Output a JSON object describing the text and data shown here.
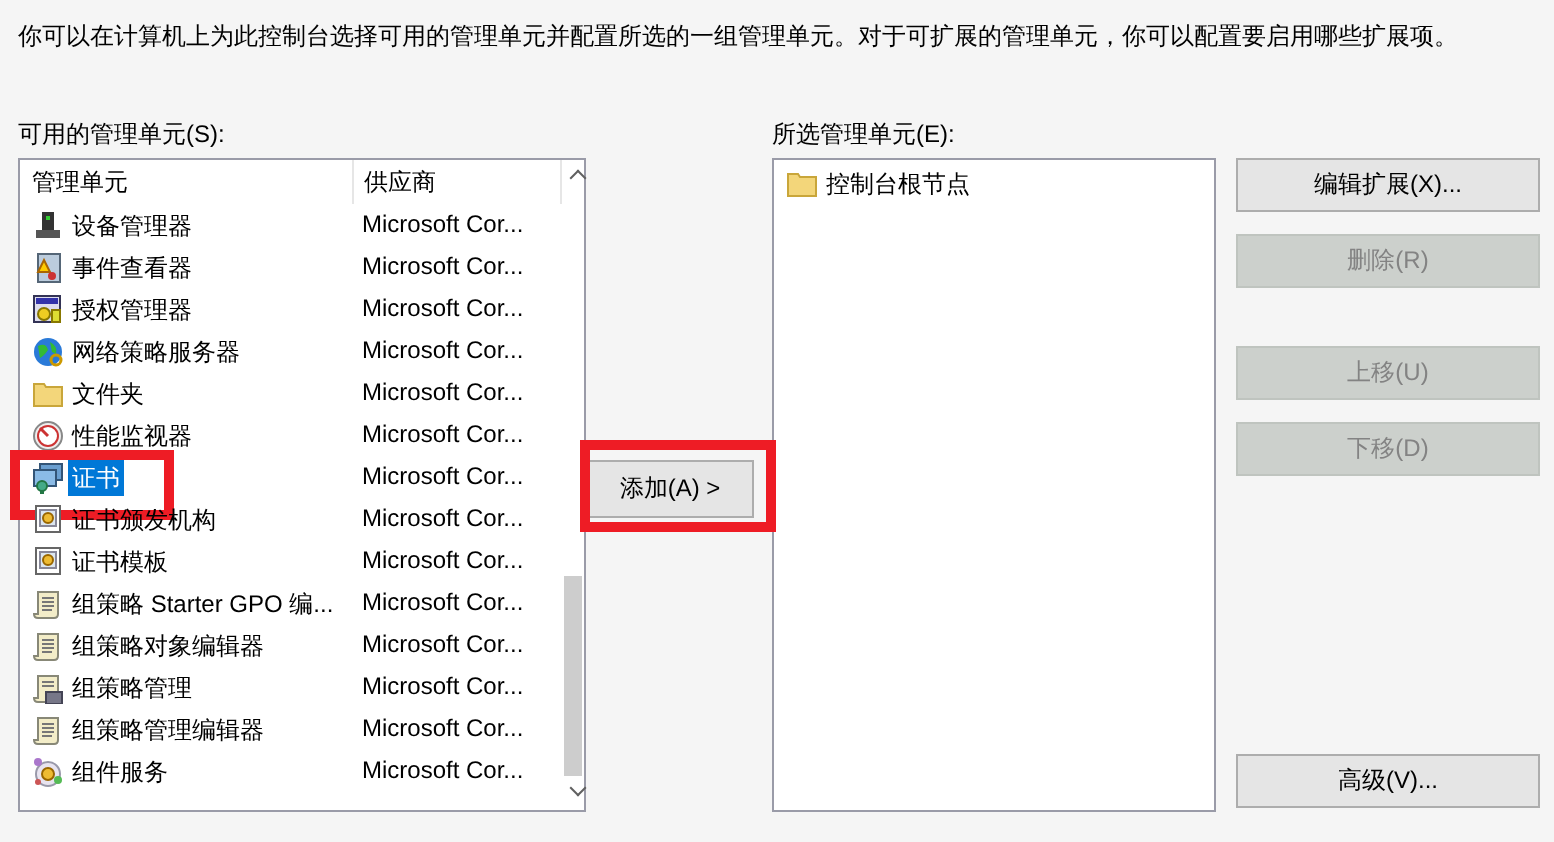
{
  "description": "你可以在计算机上为此控制台选择可用的管理单元并配置所选的一组管理单元。对于可扩展的管理单元，你可以配置要启用哪些扩展项。",
  "available": {
    "label": "可用的管理单元(S):",
    "columns": [
      "管理单元",
      "供应商"
    ],
    "rows": [
      {
        "kind": "device",
        "name": "设备管理器",
        "vendor": "Microsoft Cor...",
        "selected": false,
        "highlighted": false
      },
      {
        "kind": "log",
        "name": "事件查看器",
        "vendor": "Microsoft Cor...",
        "selected": false,
        "highlighted": false
      },
      {
        "kind": "license",
        "name": "授权管理器",
        "vendor": "Microsoft Cor...",
        "selected": false,
        "highlighted": false
      },
      {
        "kind": "globe",
        "name": "网络策略服务器",
        "vendor": "Microsoft Cor...",
        "selected": false,
        "highlighted": false
      },
      {
        "kind": "folder",
        "name": "文件夹",
        "vendor": "Microsoft Cor...",
        "selected": false,
        "highlighted": false
      },
      {
        "kind": "gauge",
        "name": "性能监视器",
        "vendor": "Microsoft Cor...",
        "selected": false,
        "highlighted": false
      },
      {
        "kind": "certificate",
        "name": "证书",
        "vendor": "Microsoft Cor...",
        "selected": true,
        "highlighted": true
      },
      {
        "kind": "template",
        "name": "证书颁发机构",
        "vendor": "Microsoft Cor...",
        "selected": false,
        "highlighted": false
      },
      {
        "kind": "template",
        "name": "证书模板",
        "vendor": "Microsoft Cor...",
        "selected": false,
        "highlighted": false
      },
      {
        "kind": "scroll",
        "name": "组策略 Starter GPO 编...",
        "vendor": "Microsoft Cor...",
        "selected": false,
        "highlighted": false
      },
      {
        "kind": "scroll",
        "name": "组策略对象编辑器",
        "vendor": "Microsoft Cor...",
        "selected": false,
        "highlighted": false
      },
      {
        "kind": "scroll-lock",
        "name": "组策略管理",
        "vendor": "Microsoft Cor...",
        "selected": false,
        "highlighted": false
      },
      {
        "kind": "scroll",
        "name": "组策略管理编辑器",
        "vendor": "Microsoft Cor...",
        "selected": false,
        "highlighted": false
      },
      {
        "kind": "component",
        "name": "组件服务",
        "vendor": "Microsoft Cor...",
        "selected": false,
        "highlighted": false
      }
    ]
  },
  "add_button": {
    "label": "添加(A) >",
    "highlighted": true
  },
  "selected_snapins": {
    "label": "所选管理单元(E):",
    "items": [
      {
        "kind": "folder",
        "name": "控制台根节点"
      }
    ]
  },
  "button_groups": [
    [
      {
        "label": "编辑扩展(X)...",
        "disabled": false
      },
      {
        "label": "删除(R)",
        "disabled": true
      }
    ],
    [
      {
        "label": "上移(U)",
        "disabled": true
      },
      {
        "label": "下移(D)",
        "disabled": true
      }
    ],
    [
      {
        "label": "高级(V)...",
        "disabled": false
      }
    ]
  ]
}
